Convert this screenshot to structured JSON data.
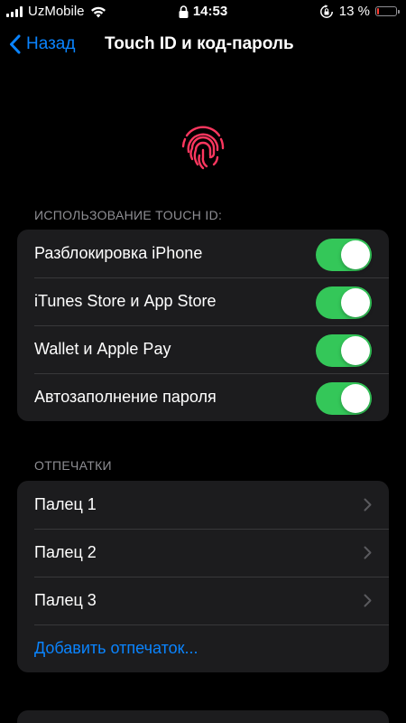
{
  "status_bar": {
    "carrier": "UzMobile",
    "time": "14:53",
    "battery_text": "13 %",
    "battery_level": 0.13,
    "icons": [
      "signal-icon",
      "wifi-icon",
      "lock-icon",
      "rotation-lock-icon",
      "battery-icon"
    ]
  },
  "nav": {
    "back_label": "Назад",
    "title": "Touch ID и код-пароль"
  },
  "colors": {
    "accent": "#0a84ff",
    "toggle_on": "#34c759",
    "fingerprint": "#ff375f",
    "cell_bg": "#1c1c1e",
    "separator": "#38383a",
    "section_header": "#8e8e93",
    "battery_low": "#ff3b30"
  },
  "touch_id_section": {
    "header": "ИСПОЛЬЗОВАНИЕ TOUCH ID:",
    "items": [
      {
        "label": "Разблокировка iPhone",
        "enabled": true
      },
      {
        "label": "iTunes Store и App Store",
        "enabled": true
      },
      {
        "label": "Wallet и Apple Pay",
        "enabled": true
      },
      {
        "label": "Автозаполнение пароля",
        "enabled": true
      }
    ]
  },
  "fingerprints_section": {
    "header": "ОТПЕЧАТКИ",
    "items": [
      {
        "label": "Палец 1"
      },
      {
        "label": "Палец 2"
      },
      {
        "label": "Палец 3"
      }
    ],
    "add_label": "Добавить отпечаток..."
  }
}
